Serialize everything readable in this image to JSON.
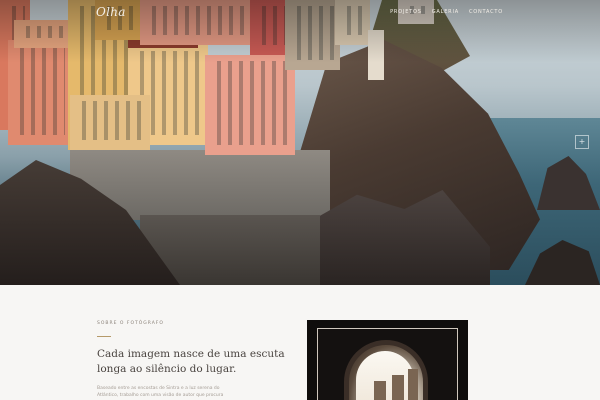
{
  "header": {
    "brand": "Olha",
    "nav": [
      "Projetos",
      "Galeria",
      "Contacto"
    ]
  },
  "hero": {
    "arrow_icon": "+"
  },
  "about": {
    "eyebrow": "Sobre o fotógrafo",
    "headline": "Cada imagem nasce de uma escuta longa ao silêncio do lugar.",
    "body": "Baseado entre as encostas de Sintra e a luz serena do Atlântico, trabalho com uma visão de autor que procura"
  },
  "colors": {
    "accent": "#b59a6a",
    "background": "#f7f6f4",
    "text": "#4a4440"
  }
}
